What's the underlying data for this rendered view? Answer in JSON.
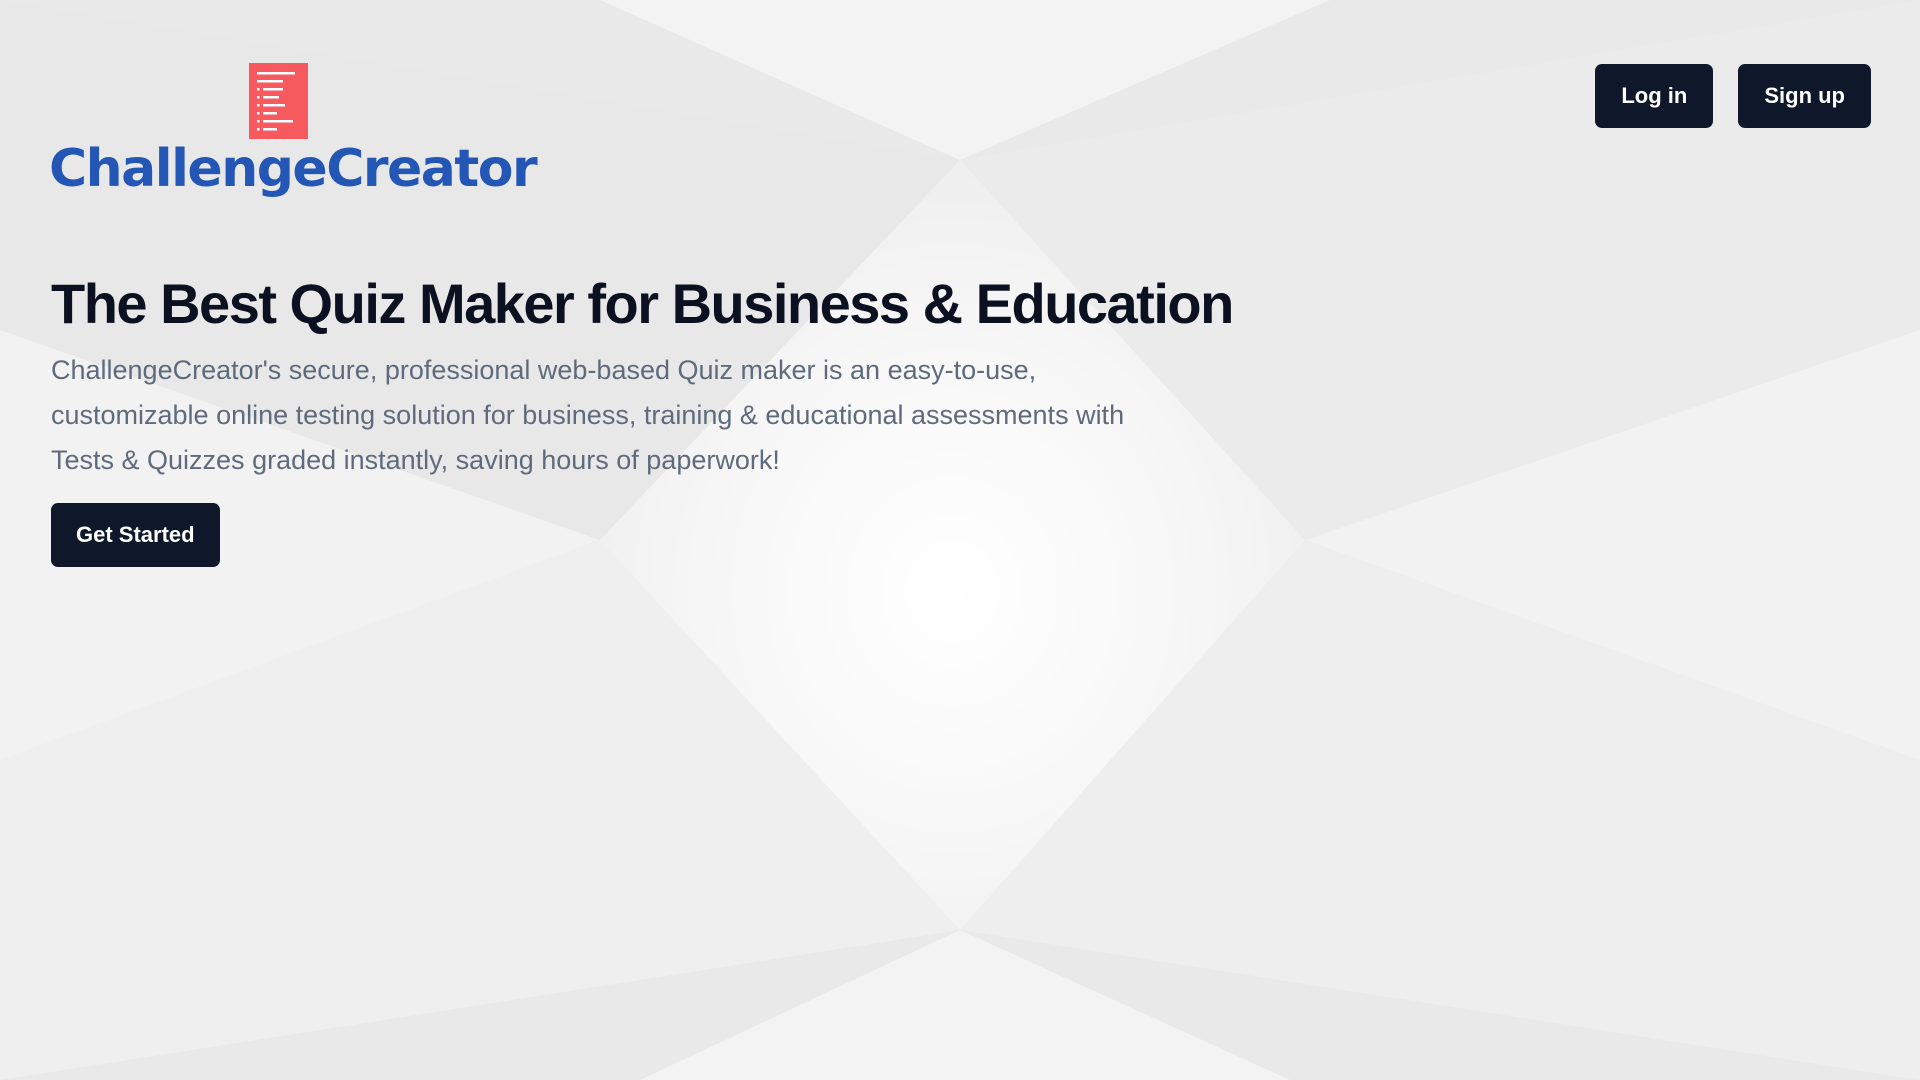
{
  "brand": {
    "name": "ChallengeCreator",
    "icon": "document-list-icon",
    "icon_color": "#f65a5f",
    "text_color": "#2356b5"
  },
  "nav": {
    "login_label": "Log in",
    "signup_label": "Sign up"
  },
  "hero": {
    "title": "The Best Quiz Maker for Business & Education",
    "description": "ChallengeCreator's secure, professional web-based Quiz maker is an easy-to-use, customizable online testing solution for business, training & educational assessments with Tests & Quizzes graded instantly, saving hours of paperwork!",
    "cta_label": "Get Started"
  },
  "theme": {
    "button_bg": "#0f172a",
    "button_text": "#ffffff",
    "heading_color": "#0b1120",
    "body_text_color": "#5f6b7d",
    "background": "#ececec"
  }
}
